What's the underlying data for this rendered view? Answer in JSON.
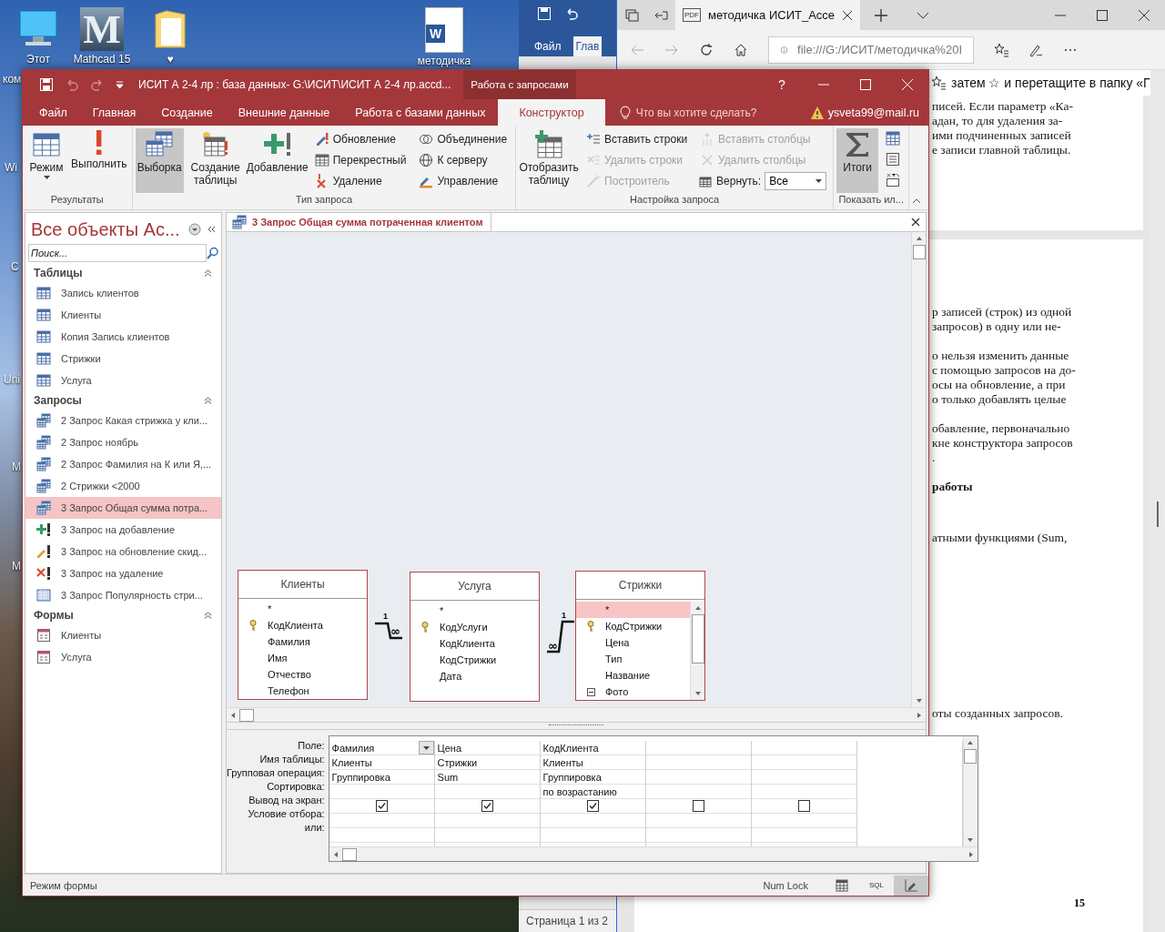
{
  "desktop": {
    "icons": [
      {
        "kind": "computer",
        "label": "Этот"
      },
      {
        "kind": "app",
        "label": "Mathcad 15",
        "glyph": "M"
      },
      {
        "kind": "folder",
        "label": "♥"
      },
      {
        "kind": "document",
        "label": "методичка",
        "glyph": "W"
      }
    ],
    "edge_labels": [
      "ком",
      "Wi",
      "C",
      "Uni",
      "M",
      "M"
    ]
  },
  "word_window": {
    "tabs": [
      {
        "label": "Файл",
        "selected": false
      },
      {
        "label": "Глав",
        "selected": true
      }
    ],
    "status": "Страница 1 из 2"
  },
  "browser": {
    "tab_icon_text": "PDF",
    "tab_title": "методичка ИСИТ_Acce",
    "address": "file:///G:/ИСИТ/методичка%20I",
    "hint": "затем ☆ и перетащите в папку «Г",
    "pages": [
      {
        "paragraphs": [
          {
            "bold": false,
            "lines": [
              "писей. Если параметр «Ка-",
              "адан, то для удаления за-",
              "ими подчиненных записей",
              "е записи главной таблицы."
            ]
          }
        ]
      },
      {
        "paragraphs": [
          {
            "bold": false,
            "lines": [
              "р записей (строк) из одной",
              "запросов) в одну или не-"
            ]
          },
          {
            "bold": false,
            "lines": [
              "о нельзя изменить данные",
              "с помощью запросов на до-",
              "осы на обновление, а при",
              "о только добавлять целые"
            ]
          },
          {
            "bold": false,
            "lines": [
              "обавление, первоначально",
              "кне конструктора запросов",
              "."
            ]
          },
          {
            "bold": true,
            "lines": [
              "работы"
            ]
          },
          {
            "bold": false,
            "lines": [
              "атными функциями (Sum,"
            ]
          },
          {
            "bold": false,
            "lines": [
              "оты созданных запросов."
            ]
          }
        ],
        "page_number": "15"
      }
    ]
  },
  "access": {
    "title": "ИСИТ А 2-4 лр : база данных- G:\\ИСИТ\\ИСИТ А 2-4 лр.accd...",
    "context_tab": "Работа с запросами",
    "help": "?",
    "tabs": [
      {
        "label": "Файл",
        "selected": false
      },
      {
        "label": "Главная",
        "selected": false
      },
      {
        "label": "Создание",
        "selected": false
      },
      {
        "label": "Внешние данные",
        "selected": false
      },
      {
        "label": "Работа с базами данных",
        "selected": false
      },
      {
        "label": "Конструктор",
        "selected": true
      }
    ],
    "tell_me": "Что вы хотите сделать?",
    "user": "ysveta99@mail.ru",
    "ribbon": [
      {
        "label": "Результаты",
        "items": [
          {
            "kind": "large",
            "label": "Режим",
            "dropdown": true,
            "selected": false
          },
          {
            "kind": "large",
            "label": "Выполнить",
            "dropdown": false,
            "selected": false
          }
        ]
      },
      {
        "label": "Тип запроса",
        "items": [
          {
            "kind": "large",
            "label": "Выборка",
            "dropdown": false,
            "selected": true
          },
          {
            "kind": "large",
            "label": "Создание таблицы",
            "dropdown": false,
            "selected": false
          },
          {
            "kind": "large",
            "label": "Добавление",
            "dropdown": false,
            "selected": false
          },
          {
            "kind": "small",
            "label": "Обновление",
            "disabled": false
          },
          {
            "kind": "small",
            "label": "Перекрестный",
            "disabled": false
          },
          {
            "kind": "small",
            "label": "Удаление",
            "disabled": false
          },
          {
            "kind": "small",
            "label": "Объединение",
            "disabled": false
          },
          {
            "kind": "small",
            "label": "К серверу",
            "disabled": false
          },
          {
            "kind": "small",
            "label": "Управление",
            "disabled": false
          }
        ]
      },
      {
        "label": "Настройка запроса",
        "items": [
          {
            "kind": "large",
            "label": "Отобразить таблицу",
            "dropdown": false,
            "selected": false
          },
          {
            "kind": "small",
            "label": "Вставить строки",
            "disabled": false
          },
          {
            "kind": "small",
            "label": "Удалить строки",
            "disabled": true
          },
          {
            "kind": "small",
            "label": "Построитель",
            "disabled": true
          },
          {
            "kind": "small",
            "label": "Вставить столбцы",
            "disabled": true
          },
          {
            "kind": "small",
            "label": "Удалить столбцы",
            "disabled": true
          },
          {
            "kind": "combo",
            "label": "Вернуть:",
            "value": "Все"
          }
        ]
      },
      {
        "label": "Показать ил...",
        "items": [
          {
            "kind": "large",
            "label": "Итоги",
            "dropdown": false,
            "selected": true
          },
          {
            "kind": "tool"
          },
          {
            "kind": "tool"
          },
          {
            "kind": "tool"
          }
        ]
      }
    ],
    "nav": {
      "title": "Все объекты Ac...",
      "search_placeholder": "Поиск...",
      "sections": [
        {
          "label": "Таблицы",
          "expanded": true,
          "items": [
            {
              "kind": "table",
              "label": "Запись клиентов",
              "selected": false
            },
            {
              "kind": "table",
              "label": "Клиенты",
              "selected": false
            },
            {
              "kind": "table",
              "label": "Копия Запись клиентов",
              "selected": false
            },
            {
              "kind": "table",
              "label": "Стрижки",
              "selected": false
            },
            {
              "kind": "table",
              "label": "Услуга",
              "selected": false
            }
          ]
        },
        {
          "label": "Запросы",
          "expanded": true,
          "items": [
            {
              "kind": "select",
              "label": "2 Запрос Какая стрижка у кли...",
              "selected": false
            },
            {
              "kind": "select",
              "label": "2 Запрос ноябрь",
              "selected": false
            },
            {
              "kind": "select",
              "label": "2 Запрос Фамилия на К или Я,...",
              "selected": false
            },
            {
              "kind": "select",
              "label": "2 Стрижки <2000",
              "selected": false
            },
            {
              "kind": "select",
              "label": "3 Запрос Общая сумма потра...",
              "selected": true
            },
            {
              "kind": "append",
              "label": "3 Запрос на добавление",
              "selected": false
            },
            {
              "kind": "update",
              "label": "3 Запрос на обновление скид...",
              "selected": false
            },
            {
              "kind": "delete",
              "label": "3 Запрос на удаление",
              "selected": false
            },
            {
              "kind": "crosstab",
              "label": "3 Запрос Популярность стри...",
              "selected": false
            }
          ]
        },
        {
          "label": "Формы",
          "expanded": true,
          "items": [
            {
              "kind": "form",
              "label": "Клиенты",
              "selected": false
            },
            {
              "kind": "form",
              "label": "Услуга",
              "selected": false
            }
          ]
        }
      ]
    },
    "document_tab": "3 Запрос Общая сумма потраченная клиентом",
    "tables": [
      {
        "name": "Клиенты",
        "scrollbar": false,
        "fields": [
          {
            "kind": "all",
            "name": "*",
            "selected": false
          },
          {
            "kind": "key",
            "name": "КодКлиента",
            "selected": false
          },
          {
            "kind": "plain",
            "name": "Фамилия",
            "selected": false
          },
          {
            "kind": "plain",
            "name": "Имя",
            "selected": false
          },
          {
            "kind": "plain",
            "name": "Отчество",
            "selected": false
          },
          {
            "kind": "plain",
            "name": "Телефон",
            "selected": false
          }
        ]
      },
      {
        "name": "Услуга",
        "scrollbar": false,
        "fields": [
          {
            "kind": "all",
            "name": "*",
            "selected": false
          },
          {
            "kind": "key",
            "name": "КодУслуги",
            "selected": false
          },
          {
            "kind": "plain",
            "name": "КодКлиента",
            "selected": false
          },
          {
            "kind": "plain",
            "name": "КодСтрижки",
            "selected": false
          },
          {
            "kind": "plain",
            "name": "Дата",
            "selected": false
          }
        ]
      },
      {
        "name": "Стрижки",
        "scrollbar": true,
        "fields": [
          {
            "kind": "all",
            "name": "*",
            "selected": true
          },
          {
            "kind": "key",
            "name": "КодСтрижки",
            "selected": false
          },
          {
            "kind": "plain",
            "name": "Цена",
            "selected": false
          },
          {
            "kind": "plain",
            "name": "Тип",
            "selected": false
          },
          {
            "kind": "plain",
            "name": "Название",
            "selected": false
          },
          {
            "kind": "multivalue",
            "name": "Фото",
            "selected": false
          }
        ]
      }
    ],
    "relationships": [
      {
        "one_label": "1",
        "many_label": "∞"
      },
      {
        "one_label": "1",
        "many_label": "∞"
      }
    ],
    "grid": {
      "row_labels": [
        "Поле:",
        "Имя таблицы:",
        "Групповая операция:",
        "Сортировка:",
        "Вывод на экран:",
        "Условие отбора:",
        "или:"
      ],
      "columns": [
        {
          "field": "Фамилия",
          "table": "Клиенты",
          "total": "Группировка",
          "show": true,
          "active": true
        },
        {
          "field": "Цена",
          "table": "Стрижки",
          "total": "Sum",
          "show": true,
          "active": false
        },
        {
          "field": "КодКлиента",
          "table": "Клиенты",
          "total": "Группировка",
          "sort": "по возрастанию",
          "show": true,
          "active": false
        },
        {
          "show": false,
          "active": false
        },
        {
          "show": false,
          "active": false
        }
      ]
    },
    "status_bar": {
      "mode": "Режим формы",
      "num_lock": "Num Lock",
      "views": [
        {
          "kind": "datasheet",
          "selected": false
        },
        {
          "kind": "sql",
          "label": "SQL",
          "selected": false
        },
        {
          "kind": "design",
          "selected": true
        }
      ]
    }
  }
}
